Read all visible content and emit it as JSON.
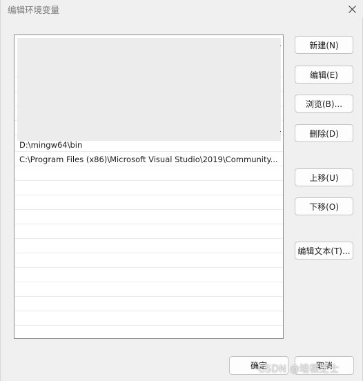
{
  "window": {
    "title": "编辑环境变量"
  },
  "list": {
    "items": [
      "D:\\mingw64\\bin",
      "C:\\Program Files (x86)\\Microsoft Visual Studio\\2019\\Community..."
    ]
  },
  "buttons": {
    "new": "新建(N)",
    "edit": "编辑(E)",
    "browse": "浏览(B)...",
    "delete": "删除(D)",
    "move_up": "上移(U)",
    "move_down": "下移(O)",
    "edit_text": "编辑文本(T)...",
    "ok": "确定",
    "cancel": "取消"
  },
  "watermark": {
    "text": "CSDN @培根芝士"
  },
  "icons": {
    "close": "close-icon"
  }
}
